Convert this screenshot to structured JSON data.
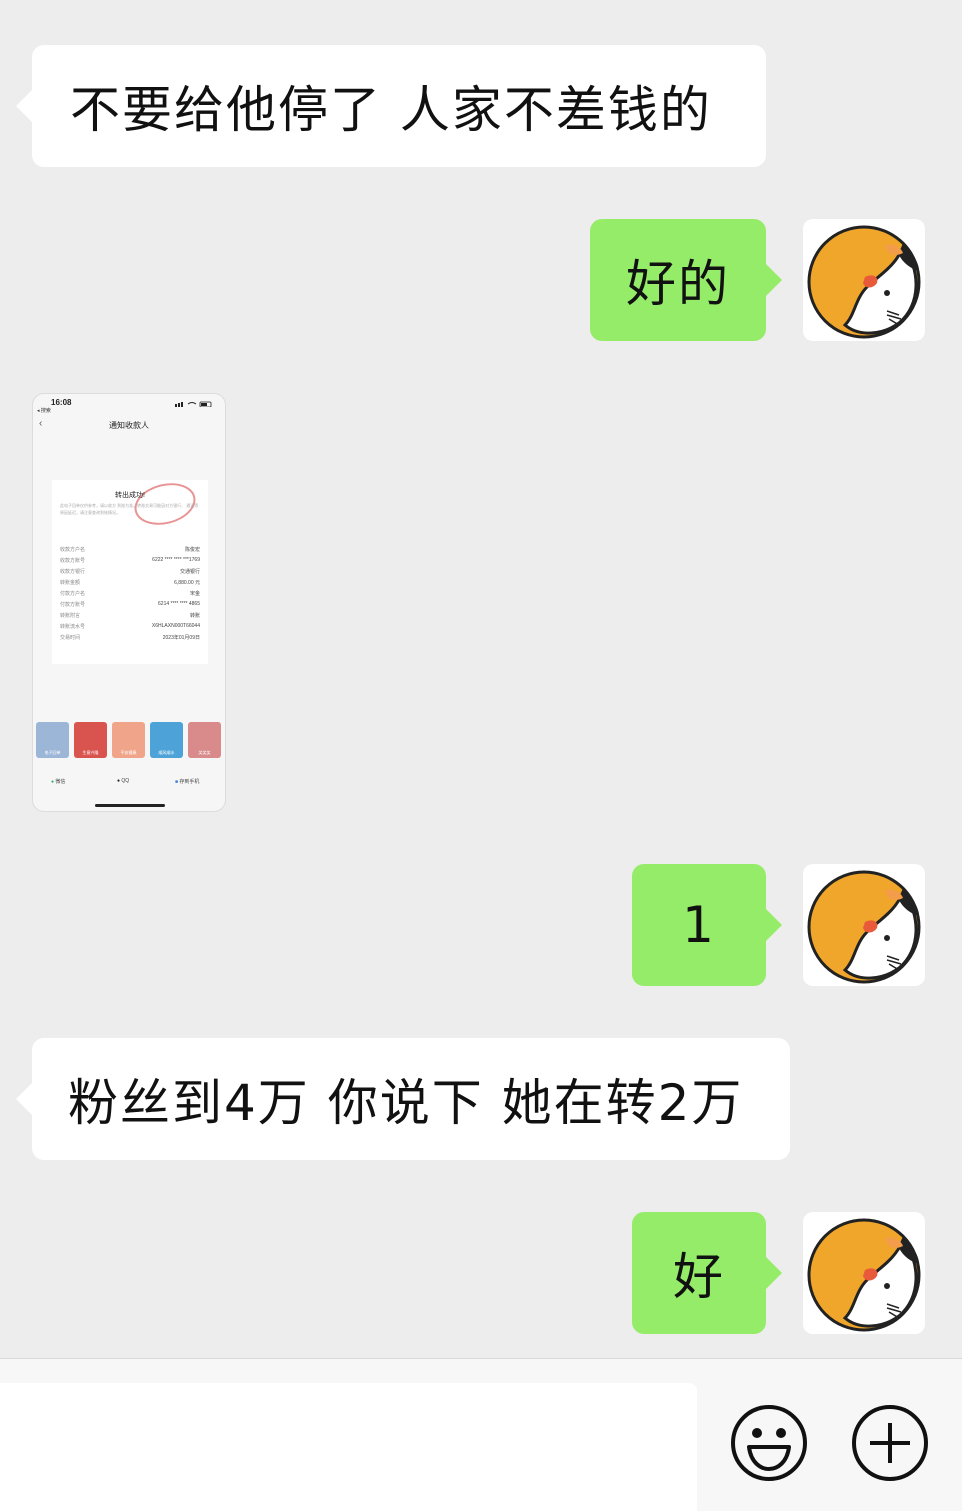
{
  "messages": [
    {
      "direction": "incoming",
      "text": "不要给他停了  人家不差钱的"
    },
    {
      "direction": "outgoing",
      "text": "好的",
      "avatar_icon": "cat-dog-avatar-icon"
    },
    {
      "direction": "incoming",
      "type": "image",
      "image": {
        "status_time": "16:08",
        "status_back": "◂ 搜索",
        "nav_title": "通知收款人",
        "receipt_title": "转出成功!",
        "receipt_desc": "此电子回单仅供参考，请以收方 到账为准。转账交易可能因对方银行、 通讯等原因延迟，请注意查询到账情况。",
        "rows": [
          {
            "label": "收款方户名",
            "value": "陈俊宏"
          },
          {
            "label": "收款方账号",
            "value": "6222 **** **** ***1769"
          },
          {
            "label": "收款方银行",
            "value": "交通银行"
          },
          {
            "label": "转账金额",
            "value": "6,880.00 元"
          },
          {
            "label": "付款方户名",
            "value": "宋金"
          },
          {
            "label": "付款方账号",
            "value": "6214 **** **** 4865"
          },
          {
            "label": "转账附言",
            "value": "转账"
          },
          {
            "label": "转账流水号",
            "value": "X6HLAXN000T66044"
          },
          {
            "label": "交易时间",
            "value": "2023年01月09日"
          }
        ],
        "share_tiles": [
          {
            "label": "电子回单",
            "color": "#9cb6d8"
          },
          {
            "label": "生意兴隆",
            "color": "#d9534f"
          },
          {
            "label": "平安健康",
            "color": "#f0a58a"
          },
          {
            "label": "顺风顺水",
            "color": "#4da3d8"
          },
          {
            "label": "笑笑笑",
            "color": "#d98a8a"
          }
        ],
        "share_targets": [
          "微信",
          "QQ",
          "存到手机"
        ]
      }
    },
    {
      "direction": "outgoing",
      "text": "1",
      "avatar_icon": "cat-dog-avatar-icon"
    },
    {
      "direction": "incoming",
      "text": "粉丝到4万 你说下 她在转2万"
    },
    {
      "direction": "outgoing",
      "text": "好",
      "avatar_icon": "cat-dog-avatar-icon"
    }
  ],
  "input_bar": {
    "value": "",
    "emoji_icon": "emoji-icon",
    "add_icon": "plus-circle-icon"
  },
  "colors": {
    "background": "#ededed",
    "incoming_bubble": "#ffffff",
    "outgoing_bubble": "#95ec69"
  }
}
